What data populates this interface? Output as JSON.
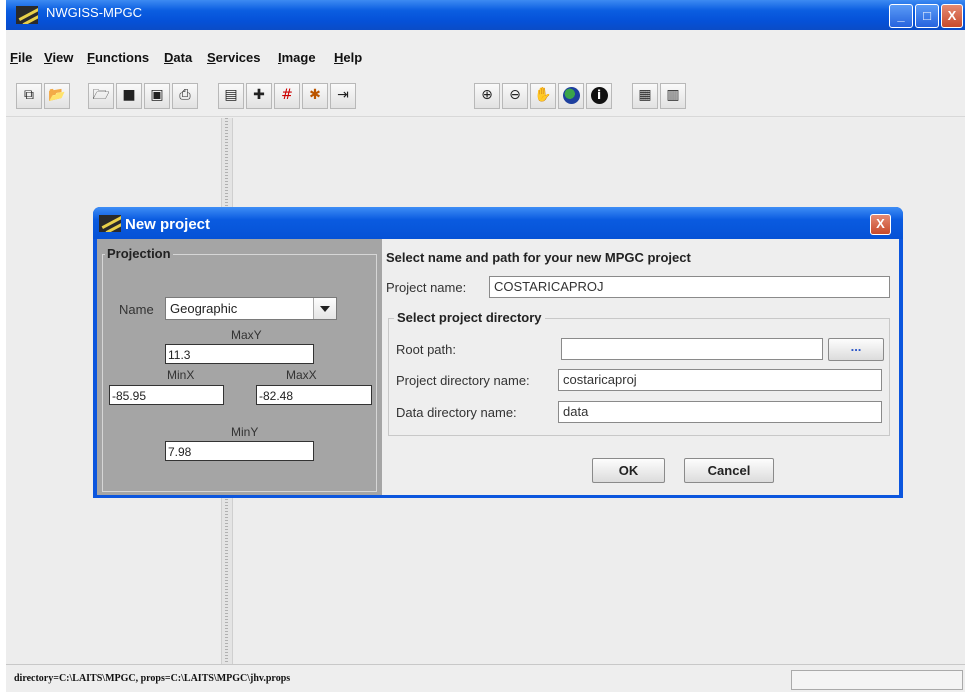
{
  "app": {
    "title": "NWGISS-MPGC",
    "window_buttons": {
      "minimize": "_",
      "maximize": "□",
      "close": "X"
    }
  },
  "menu": [
    "File",
    "View",
    "Functions",
    "Data",
    "Services",
    "Image",
    "Help"
  ],
  "toolbar_icons": [
    "new-window-icon",
    "open-folder-icon",
    "folder-open-icon",
    "save-icon",
    "save-all-icon",
    "print-icon",
    "clipboard-icon",
    "add-layer-icon",
    "grid-icon",
    "palette-icon",
    "export-icon",
    "zoom-in-icon",
    "zoom-out-icon",
    "pan-hand-icon",
    "globe-icon",
    "info-icon",
    "layers-icon",
    "document-icon"
  ],
  "dialog": {
    "title": "New project",
    "close": "X",
    "projection": {
      "legend": "Projection",
      "name_label": "Name",
      "name_value": "Geographic",
      "maxy_label": "MaxY",
      "maxy_value": "11.3",
      "minx_label": "MinX",
      "minx_value": "-85.95",
      "maxx_label": "MaxX",
      "maxx_value": "-82.48",
      "miny_label": "MinY",
      "miny_value": "7.98"
    },
    "heading": "Select name and path for your new MPGC project",
    "project_name_label": "Project name:",
    "project_name_value": "COSTARICAPROJ",
    "directory": {
      "legend": "Select project directory",
      "root_path_label": "Root path:",
      "root_path_value": "",
      "browse_label": "...",
      "project_dir_label": "Project directory name:",
      "project_dir_value": "costaricaproj",
      "data_dir_label": "Data directory name:",
      "data_dir_value": "data"
    },
    "ok_label": "OK",
    "cancel_label": "Cancel"
  },
  "status": {
    "text": "directory=C:\\LAITS\\MPGC, props=C:\\LAITS\\MPGC\\jhv.props"
  }
}
